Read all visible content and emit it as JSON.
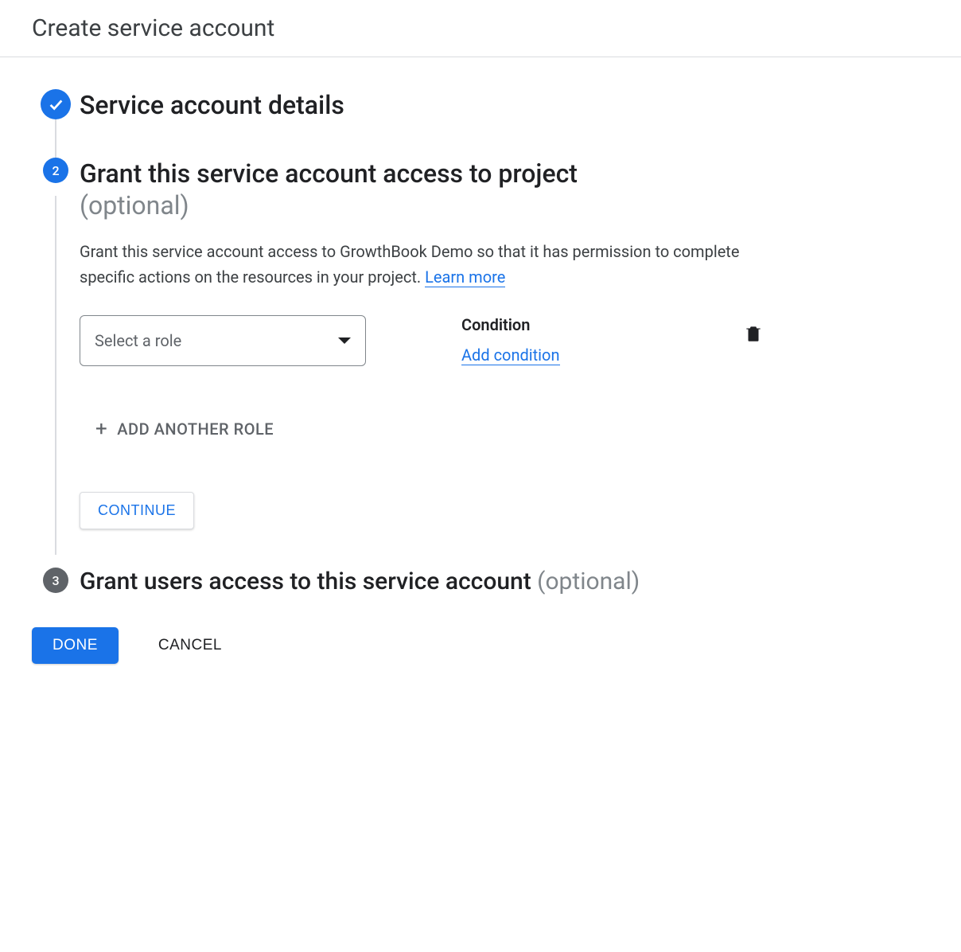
{
  "header": {
    "title": "Create service account"
  },
  "steps": {
    "step1": {
      "title": "Service account details"
    },
    "step2": {
      "number": "2",
      "title": "Grant this service account access to project",
      "optional": "(optional)",
      "description": "Grant this service account access to GrowthBook Demo so that it has permission to complete specific actions on the resources in your project. ",
      "learn_more": "Learn more",
      "role_placeholder": "Select a role",
      "condition_label": "Condition",
      "add_condition": "Add condition",
      "add_another_role": "ADD ANOTHER ROLE",
      "continue": "CONTINUE"
    },
    "step3": {
      "number": "3",
      "title": "Grant users access to this service account ",
      "optional": "(optional)"
    }
  },
  "footer": {
    "done": "DONE",
    "cancel": "CANCEL"
  }
}
